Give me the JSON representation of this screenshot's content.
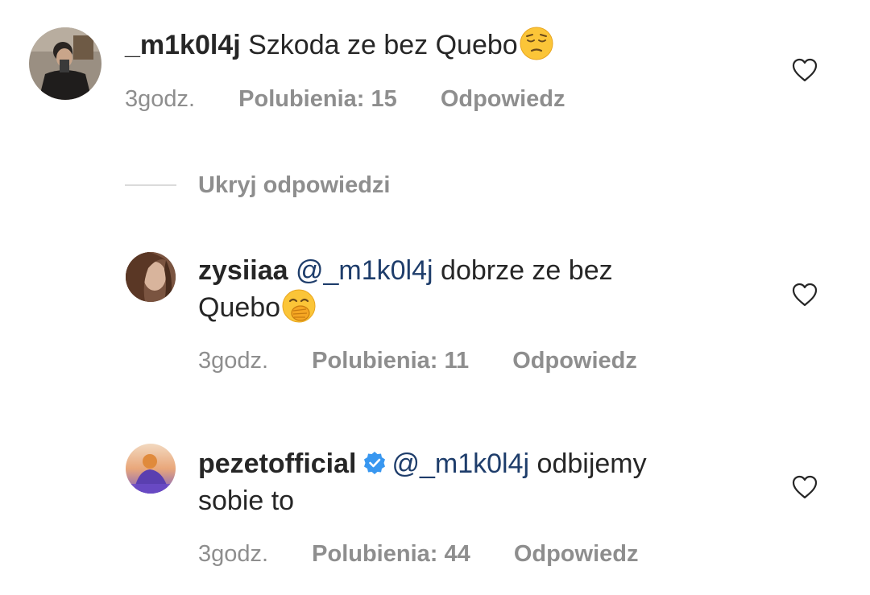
{
  "comments": [
    {
      "username": "_m1k0l4j",
      "text": "Szkoda ze bez Quebo",
      "emoji": "pensive-face",
      "time": "3godz.",
      "likes": "Polubienia: 15",
      "reply": "Odpowiedz"
    },
    {
      "username": "zysiiaa",
      "mention": "@_m1k0l4j",
      "text_line1": "dobrze ze bez",
      "text_line2": "Quebo",
      "emoji": "face-with-hand-over-mouth",
      "time": "3godz.",
      "likes": "Polubienia: 11",
      "reply": "Odpowiedz"
    },
    {
      "username": "pezetofficial",
      "verified": true,
      "mention": "@_m1k0l4j",
      "text_line1": "odbijemy",
      "text_line2": "sobie to",
      "time": "3godz.",
      "likes": "Polubienia: 44",
      "reply": "Odpowiedz"
    }
  ],
  "hide_replies_label": "Ukryj odpowiedzi",
  "colors": {
    "text": "#262626",
    "meta": "#8e8e8e",
    "mention": "#1e3d6b",
    "verified": "#3897f0",
    "divider": "#dbdbdb"
  }
}
